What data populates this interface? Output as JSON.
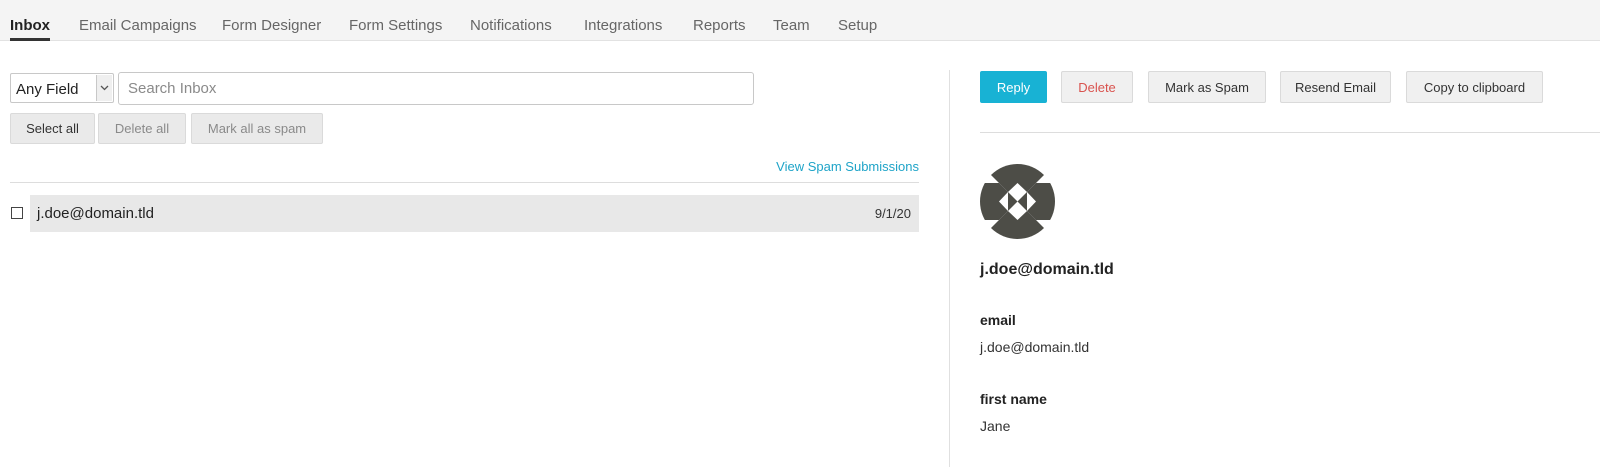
{
  "tabs": [
    {
      "label": "Inbox",
      "active": true
    },
    {
      "label": "Email Campaigns"
    },
    {
      "label": "Form Designer"
    },
    {
      "label": "Form Settings"
    },
    {
      "label": "Notifications"
    },
    {
      "label": "Integrations"
    },
    {
      "label": "Reports"
    },
    {
      "label": "Team"
    },
    {
      "label": "Setup"
    }
  ],
  "filter": {
    "field_select_value": "Any Field",
    "search_placeholder": "Search Inbox",
    "search_value": ""
  },
  "bulk_actions": {
    "select_all": "Select all",
    "delete_all": "Delete all",
    "mark_all_spam": "Mark all as spam"
  },
  "spam_link": "View Spam Submissions",
  "inbox_rows": [
    {
      "email": "j.doe@domain.tld",
      "date": "9/1/20",
      "checked": false
    }
  ],
  "actions": {
    "reply": "Reply",
    "delete": "Delete",
    "mark_spam": "Mark as Spam",
    "resend": "Resend Email",
    "copy": "Copy to clipboard"
  },
  "detail": {
    "name": "j.doe@domain.tld",
    "fields": [
      {
        "label": "email",
        "value": "j.doe@domain.tld"
      },
      {
        "label": "first name",
        "value": "Jane"
      }
    ]
  },
  "colors": {
    "accent": "#18b2d4",
    "link": "#1fa4c8",
    "danger": "#d9534f",
    "avatar": "#4d4d47"
  }
}
